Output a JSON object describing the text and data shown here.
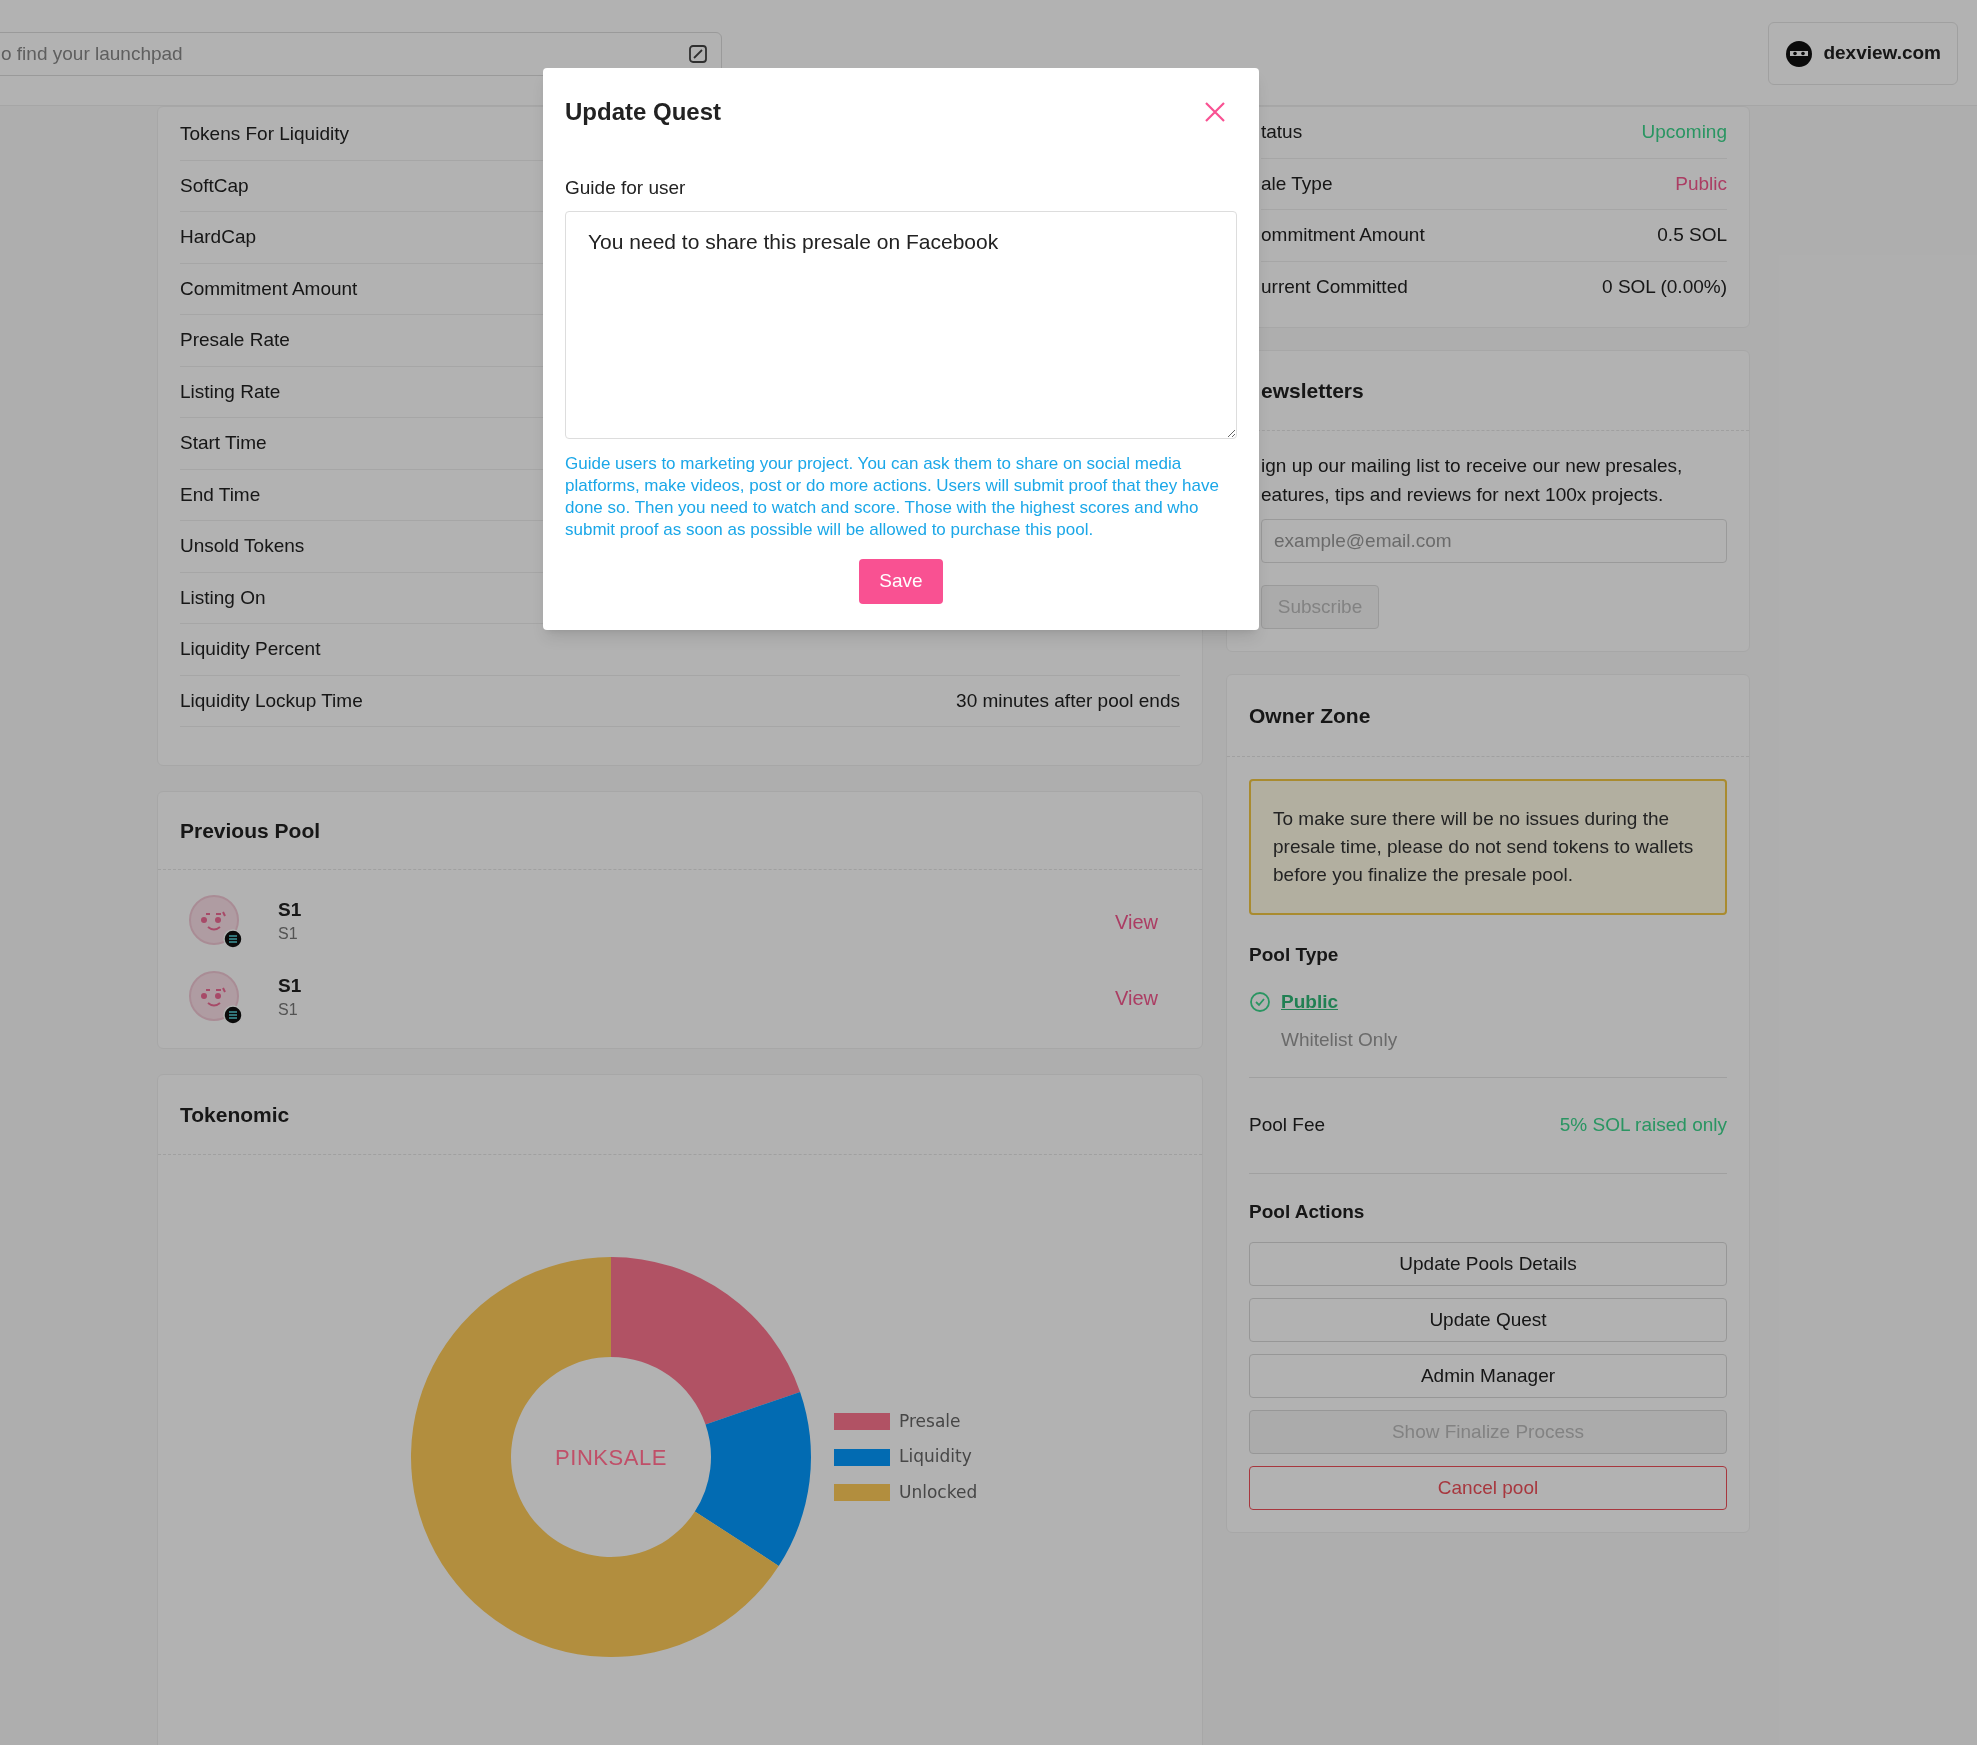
{
  "header": {
    "search": {
      "placeholder": "o find your launchpad"
    },
    "site_button": "dexview.com"
  },
  "pool_info": {
    "rows": [
      {
        "label": "Tokens For Liquidity"
      },
      {
        "label": "SoftCap"
      },
      {
        "label": "HardCap"
      },
      {
        "label": "Commitment Amount"
      },
      {
        "label": "Presale Rate"
      },
      {
        "label": "Listing Rate"
      },
      {
        "label": "Start Time"
      },
      {
        "label": "End Time"
      },
      {
        "label": "Unsold Tokens"
      },
      {
        "label": "Listing On"
      },
      {
        "label": "Liquidity Percent"
      },
      {
        "label": "Liquidity Lockup Time",
        "value": "30 minutes after pool ends"
      }
    ]
  },
  "previous_pool": {
    "title": "Previous Pool",
    "items": [
      {
        "name": "S1",
        "symbol": "S1",
        "action": "View"
      },
      {
        "name": "S1",
        "symbol": "S1",
        "action": "View"
      }
    ]
  },
  "tokenomic": {
    "title": "Tokenomic",
    "center_label": "PINKSALE",
    "legend": [
      {
        "label": "Presale",
        "color": "#b15264"
      },
      {
        "label": "Liquidity",
        "color": "#026bb2"
      },
      {
        "label": "Unlocked",
        "color": "#b28e3e"
      }
    ]
  },
  "status_card": {
    "rows": [
      {
        "label": "tatus",
        "value": "Upcoming",
        "kind": "success"
      },
      {
        "label": "ale Type",
        "value": "Public",
        "kind": "accent"
      },
      {
        "label": "ommitment Amount",
        "value": "0.5 SOL",
        "kind": "plain"
      },
      {
        "label": "urrent Committed",
        "value": "0 SOL (0.00%)",
        "kind": "plain"
      }
    ]
  },
  "newsletters": {
    "title": "ewsletters",
    "text": "ign up our mailing list to receive our new presales, eatures, tips and reviews for next 100x projects.",
    "email": {
      "placeholder": "example@email.com"
    },
    "subscribe": {
      "label": "Subscribe",
      "disabled": true
    }
  },
  "owner_zone": {
    "title": "Owner Zone",
    "notice": "To make sure there will be no issues during the presale time, please do not send tokens to wallets before you finalize the presale pool.",
    "pool_type": {
      "title": "Pool Type",
      "options": [
        {
          "label": "Public",
          "selected": true
        },
        {
          "label": "Whitelist Only",
          "selected": false
        }
      ]
    },
    "pool_fee": {
      "label": "Pool Fee",
      "value": "5% SOL raised only"
    },
    "actions_title": "Pool Actions",
    "actions": [
      {
        "label": "Update Pools Details",
        "kind": "normal",
        "disabled": false
      },
      {
        "label": "Update Quest",
        "kind": "normal",
        "disabled": false
      },
      {
        "label": "Admin Manager",
        "kind": "normal",
        "disabled": false
      },
      {
        "label": "Show Finalize Process",
        "kind": "normal",
        "disabled": true
      },
      {
        "label": "Cancel pool",
        "kind": "danger",
        "disabled": false
      }
    ]
  },
  "modal": {
    "title": "Update Quest",
    "field_label": "Guide for user",
    "value": "You need to share this presale on Facebook",
    "help": "Guide users to marketing your project. You can ask them to share on social media platforms, make videos, post or do more actions. Users will submit proof that they have done so. Then you need to watch and score. Those with the highest scores and who submit proof as soon as possible will be allowed to purchase this pool.",
    "save": "Save"
  }
}
